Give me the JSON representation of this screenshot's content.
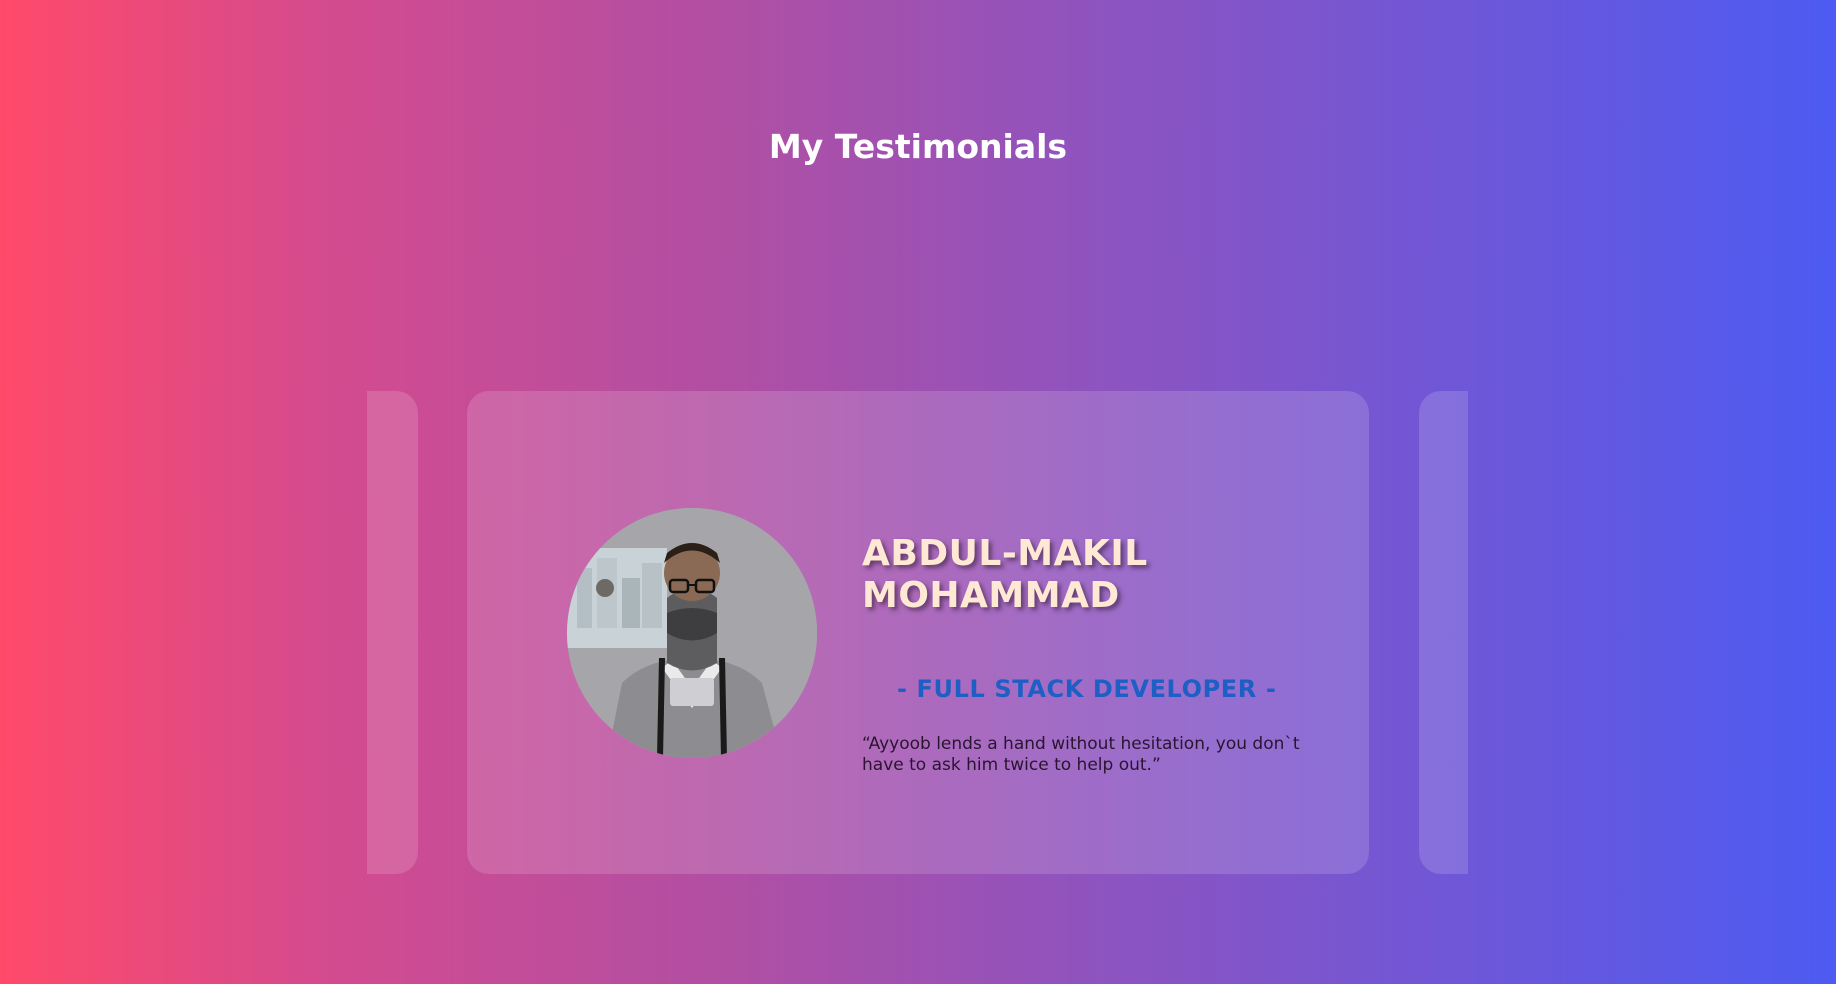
{
  "section": {
    "title": "My Testimonials"
  },
  "testimonials": {
    "active": {
      "name": "ABDUL-MAKIL MOHAMMAD",
      "role": "- FULL STACK DEVELOPER -",
      "quote": "“Ayyoob lends a hand without hesitation, you don`t have to ask him twice to help out.”",
      "avatar_icon": "person-photo"
    }
  }
}
